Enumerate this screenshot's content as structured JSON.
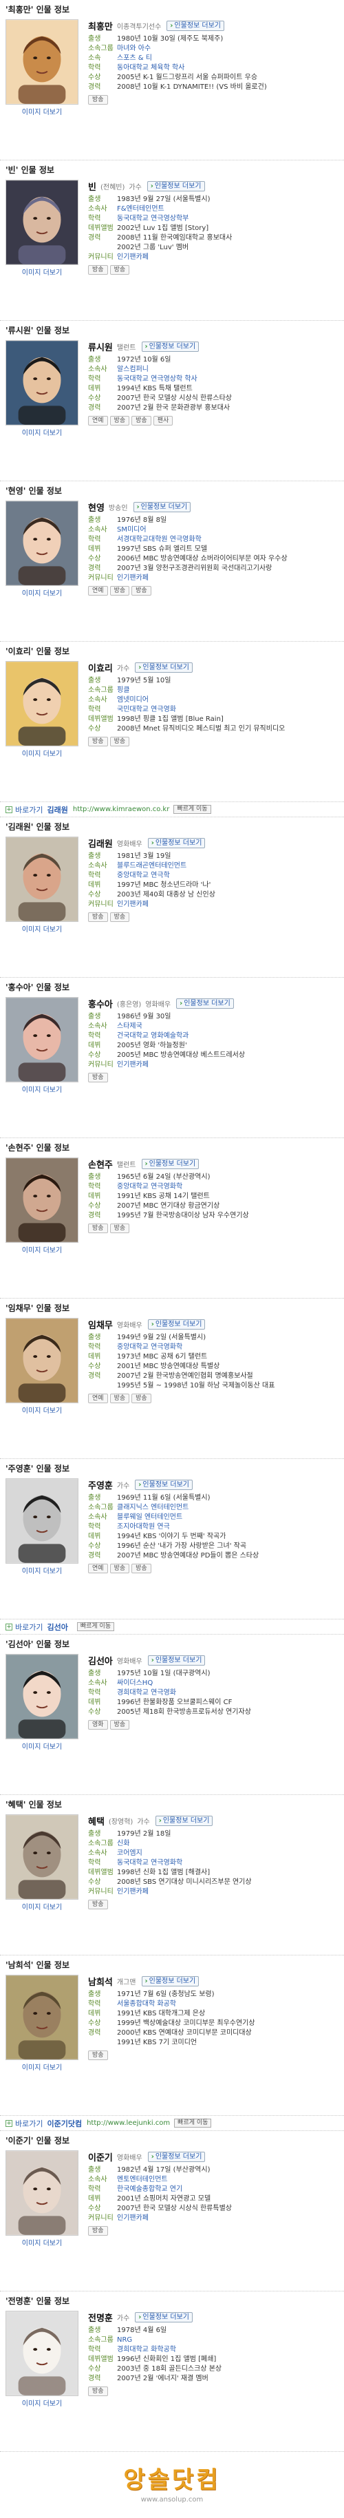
{
  "profiles": [
    {
      "section_title": "'최홍만' 인물 정보",
      "name": "최홍만",
      "sub": "이종격투기선수",
      "more": "인물정보 더보기",
      "fields": [
        {
          "k": "출생",
          "v": "1980년 10월 30일 (제주도 북제주)"
        },
        {
          "k": "소속그룹",
          "v": "마녀와 아수",
          "link": true
        },
        {
          "k": "소속",
          "v": "스포츠 & 티",
          "link": true
        },
        {
          "k": "학력",
          "v": "동아대학교 체육학 학사",
          "link": true
        },
        {
          "k": "수상",
          "v": "2005년 K-1 월드그랑프리 서울 슈퍼파이트 우승"
        },
        {
          "k": "경력",
          "v": "2008년 10월 K-1 DYNAMITE!! (VS 바비 올로건)"
        }
      ],
      "photo_link": "이미지 더보기",
      "tags": [
        "방송"
      ]
    },
    {
      "section_title": "'빈' 인물 정보",
      "name": "빈",
      "sub": "(전혜빈)",
      "role": "가수",
      "more": "인물정보 더보기",
      "fields": [
        {
          "k": "출생",
          "v": "1983년 9월 27일 (서울특별시)"
        },
        {
          "k": "소속사",
          "v": "F&엔터테인먼트",
          "link": true
        },
        {
          "k": "학력",
          "v": "동국대학교 연극영상학부",
          "link": true
        },
        {
          "k": "데뷔앨범",
          "v": "2002년 Luv 1집 앨범 [Story]"
        },
        {
          "k": "경력",
          "v": "2008년 11월 한국예임대학교 홍보대사"
        },
        {
          "k": "",
          "v": "2002년 그룹 'Luv' 멤버"
        },
        {
          "k": "커뮤니티",
          "v": "인기팬카페",
          "link": true
        }
      ],
      "photo_link": "이미지 더보기",
      "tags": [
        "방송",
        "방송"
      ]
    },
    {
      "section_title": "'류시원' 인물 정보",
      "name": "류시원",
      "role": "탤런트",
      "more": "인물정보 더보기",
      "fields": [
        {
          "k": "출생",
          "v": "1972년 10월 6일"
        },
        {
          "k": "소속사",
          "v": "알스컴퍼니",
          "link": true
        },
        {
          "k": "학력",
          "v": "동국대학교 연극영상학 학사",
          "link": true
        },
        {
          "k": "데뷔",
          "v": "1994년 KBS 특채 탤런트"
        },
        {
          "k": "수상",
          "v": "2007년 한국 모델상 시상식 한류스타상"
        },
        {
          "k": "경력",
          "v": "2007년 2월 한국 문화관광부 홍보대사"
        }
      ],
      "photo_link": "이미지 더보기",
      "tags": [
        "연예",
        "방송",
        "방송",
        "팬사"
      ]
    },
    {
      "section_title": "'현영' 인물 정보",
      "name": "현영",
      "role": "방송인",
      "more": "인물정보 더보기",
      "fields": [
        {
          "k": "출생",
          "v": "1976년 8월 8일"
        },
        {
          "k": "소속사",
          "v": "SM미디어",
          "link": true
        },
        {
          "k": "학력",
          "v": "서경대학교대학원 연극영화학",
          "link": true
        },
        {
          "k": "데뷔",
          "v": "1997년 SBS 슈퍼 엘리트 모델"
        },
        {
          "k": "수상",
          "v": "2006년 MBC 방송연예대상 쇼버라이어티부문 여자 우수상"
        },
        {
          "k": "경력",
          "v": "2007년 3월 양천구조경관리위원회 국선대리고기사랑"
        },
        {
          "k": "커뮤니티",
          "v": "인기팬카페",
          "link": true
        }
      ],
      "photo_link": "이미지 더보기",
      "tags": [
        "연예",
        "방송",
        "방송"
      ]
    },
    {
      "section_title": "'이효리' 인물 정보",
      "name": "이효리",
      "role": "가수",
      "more": "인물정보 더보기",
      "fields": [
        {
          "k": "출생",
          "v": "1979년 5월 10일"
        },
        {
          "k": "소속그룹",
          "v": "핑클",
          "link": true
        },
        {
          "k": "소속사",
          "v": "엠넷미디어",
          "link": true
        },
        {
          "k": "학력",
          "v": "국민대학교 연극영화",
          "link": true
        },
        {
          "k": "데뷔앨범",
          "v": "1998년 핑클 1집 앨범 [Blue Rain]"
        },
        {
          "k": "수상",
          "v": "2008년 Mnet 뮤직비디오 페스티벌 최고 인기 뮤직비디오"
        }
      ],
      "photo_link": "이미지 더보기",
      "tags": [
        "방송",
        "방송"
      ]
    },
    {
      "bar": {
        "label": "바로가기",
        "link": "김래원",
        "url": "http://www.kimraewon.co.kr",
        "btn": "빠르게 이동"
      },
      "section_title": "'김래원' 인물 정보",
      "name": "김래원",
      "role": "영화배우",
      "more": "인물정보 더보기",
      "fields": [
        {
          "k": "출생",
          "v": "1981년 3월 19일"
        },
        {
          "k": "소속사",
          "v": "블루드래곤엔터테인먼트",
          "link": true
        },
        {
          "k": "학력",
          "v": "중앙대학교 연극학",
          "link": true
        },
        {
          "k": "데뷔",
          "v": "1997년 MBC 청소년드라마 '나'"
        },
        {
          "k": "수상",
          "v": "2003년 제40회 대종상 남 신인상"
        },
        {
          "k": "커뮤니티",
          "v": "인기팬카페",
          "link": true
        }
      ],
      "photo_link": "이미지 더보기",
      "tags": [
        "방송",
        "방송"
      ]
    },
    {
      "section_title": "'홍수아' 인물 정보",
      "name": "홍수아",
      "sub": "(홍은영)",
      "role": "영화배우",
      "more": "인물정보 더보기",
      "fields": [
        {
          "k": "출생",
          "v": "1986년 9월 30일"
        },
        {
          "k": "소속사",
          "v": "스타제국",
          "link": true
        },
        {
          "k": "학력",
          "v": "건국대학교 영화예술학과",
          "link": true
        },
        {
          "k": "데뷔",
          "v": "2005년 영화 '하늘정원'"
        },
        {
          "k": "수상",
          "v": "2005년 MBC 방송연예대상 베스트드레서상"
        },
        {
          "k": "커뮤니티",
          "v": "인기팬카페",
          "link": true
        }
      ],
      "photo_link": "이미지 더보기",
      "tags": [
        "방송"
      ]
    },
    {
      "section_title": "'손현주' 인물 정보",
      "name": "손현주",
      "role": "탤런트",
      "more": "인물정보 더보기",
      "fields": [
        {
          "k": "출생",
          "v": "1965년 6월 24일 (부산광역시)"
        },
        {
          "k": "학력",
          "v": "중앙대학교 연극영화학",
          "link": true
        },
        {
          "k": "데뷔",
          "v": "1991년 KBS 공채 14기 탤런트"
        },
        {
          "k": "수상",
          "v": "2007년 MBC 연기대상 황금연기상"
        },
        {
          "k": "경력",
          "v": "1995년 7월 한국방송대이상 남자 우수연기상"
        }
      ],
      "photo_link": "이미지 더보기",
      "tags": [
        "방송",
        "방송"
      ]
    },
    {
      "section_title": "'임채무' 인물 정보",
      "name": "임채무",
      "role": "영화배우",
      "more": "인물정보 더보기",
      "fields": [
        {
          "k": "출생",
          "v": "1949년 9월 2일 (서울특별시)"
        },
        {
          "k": "학력",
          "v": "중앙대학교 연극영화학",
          "link": true
        },
        {
          "k": "데뷔",
          "v": "1973년 MBC 공채 6기 탤런트"
        },
        {
          "k": "수상",
          "v": "2001년 MBC 방송연예대상 특별상"
        },
        {
          "k": "경력",
          "v": "2007년 2월 한국방송연예인협회 명예홍보사절"
        },
        {
          "k": "",
          "v": "1995년 5월 ~ 1998년 10월 하남 국제놀이동산 대표"
        }
      ],
      "photo_link": "이미지 더보기",
      "tags": [
        "연예",
        "방송",
        "방송"
      ]
    },
    {
      "section_title": "'주영훈' 인물 정보",
      "name": "주영훈",
      "role": "가수",
      "more": "인물정보 더보기",
      "fields": [
        {
          "k": "출생",
          "v": "1969년 11월 6일 (서울특별시)"
        },
        {
          "k": "소속그룹",
          "v": "클래지닉스 엔터테인먼트",
          "link": true
        },
        {
          "k": "소속사",
          "v": "블루웨일 엔터테인먼트",
          "link": true
        },
        {
          "k": "학력",
          "v": "조지아대학원 연극",
          "link": true
        },
        {
          "k": "데뷔",
          "v": "1994년 KBS '이야기 두 번째' 작곡가"
        },
        {
          "k": "수상",
          "v": "1996년 순산 '내가 가장 사랑받은 그녀' 작곡"
        },
        {
          "k": "경력",
          "v": "2007년 MBC 방송연예대상 PD들이 뽑은 스타상"
        }
      ],
      "photo_link": "이미지 더보기",
      "tags": [
        "연예",
        "방송",
        "방송"
      ]
    },
    {
      "bar": {
        "label": "바로가기",
        "link": "김선아",
        "url": "",
        "btn": "빠르게 이동"
      },
      "section_title": "'김선아' 인물 정보",
      "name": "김선아",
      "role": "영화배우",
      "more": "인물정보 더보기",
      "fields": [
        {
          "k": "출생",
          "v": "1975년 10월 1일 (대구광역시)"
        },
        {
          "k": "소속사",
          "v": "싸이더스HQ",
          "link": true
        },
        {
          "k": "학력",
          "v": "경희대학교 연극영화",
          "link": true
        },
        {
          "k": "데뷔",
          "v": "1996년 한불화장품 오브쿨피스웨이 CF"
        },
        {
          "k": "수상",
          "v": "2005년 제18회 한국방송프로듀서상 연기자상"
        }
      ],
      "photo_link": "이미지 더보기",
      "tags": [
        "영화",
        "방송"
      ]
    },
    {
      "section_title": "'혜택' 인물 정보",
      "name": "혜택",
      "sub": "(장영혁)",
      "role": "가수",
      "more": "인물정보 더보기",
      "fields": [
        {
          "k": "출생",
          "v": "1979년 2월 18일"
        },
        {
          "k": "소속그룹",
          "v": "신화",
          "link": true
        },
        {
          "k": "소속사",
          "v": "코어엠지",
          "link": true
        },
        {
          "k": "학력",
          "v": "동국대학교 연극영화학",
          "link": true
        },
        {
          "k": "데뷔앨범",
          "v": "1998년 신화 1집 앨범 [해결사]"
        },
        {
          "k": "수상",
          "v": "2008년 SBS 연기대상 미니시리즈부문 연기상"
        },
        {
          "k": "커뮤니티",
          "v": "인기팬카페",
          "link": true
        }
      ],
      "photo_link": "이미지 더보기",
      "tags": [
        "방송"
      ]
    },
    {
      "section_title": "'남희석' 인물 정보",
      "name": "남희석",
      "role": "개그맨",
      "more": "인물정보 더보기",
      "fields": [
        {
          "k": "출생",
          "v": "1971년 7월 6일 (충청남도 보령)"
        },
        {
          "k": "학력",
          "v": "서울종합대학 화공학",
          "link": true
        },
        {
          "k": "데뷔",
          "v": "1991년 KBS 대학개그제 은상"
        },
        {
          "k": "수상",
          "v": "1999년 백상예술대상 코미디부문 최우수연기상"
        },
        {
          "k": "경력",
          "v": "2000년 KBS 연예대상 코미디부문 코미디대상"
        },
        {
          "k": "",
          "v": "1991년 KBS 7기 코미디언"
        }
      ],
      "photo_link": "이미지 더보기",
      "tags": [
        "방송"
      ]
    },
    {
      "bar": {
        "label": "바로가기",
        "link": "이준기닷컴",
        "url": "http://www.leejunki.com",
        "btn": "빠르게 이동"
      },
      "section_title": "'이준기' 인물 정보",
      "name": "이준기",
      "role": "영화배우",
      "more": "인물정보 더보기",
      "fields": [
        {
          "k": "출생",
          "v": "1982년 4월 17일 (부산광역시)"
        },
        {
          "k": "소속사",
          "v": "멘토엔터테인먼트",
          "link": true
        },
        {
          "k": "학력",
          "v": "한국예술종합학교 연기",
          "link": true
        },
        {
          "k": "데뷔",
          "v": "2001년 쇼핑머치 자연광고 모델"
        },
        {
          "k": "수상",
          "v": "2007년 한국 모델상 시상식 한류특별상"
        },
        {
          "k": "커뮤니티",
          "v": "인기팬카페",
          "link": true
        }
      ],
      "photo_link": "이미지 더보기",
      "tags": [
        "방송"
      ]
    },
    {
      "section_title": "'전명훈' 인물 정보",
      "name": "전명훈",
      "role": "가수",
      "more": "인물정보 더보기",
      "fields": [
        {
          "k": "출생",
          "v": "1978년 4월 6일"
        },
        {
          "k": "소속그룹",
          "v": "NRG",
          "link": true
        },
        {
          "k": "학력",
          "v": "경희대학교 화학공학",
          "link": true
        },
        {
          "k": "데뷔앨범",
          "v": "1996년 신화회인 1집 앨범 [폐쇄]"
        },
        {
          "k": "수상",
          "v": "2003년 중 18회 골든디스크상 본상"
        },
        {
          "k": "경력",
          "v": "2007년 2월 '에너지' 재결 멤버"
        }
      ],
      "photo_link": "이미지 더보기",
      "tags": [
        "방송"
      ]
    }
  ],
  "footer": {
    "logo": "앙솔닷컴",
    "url": "www.ansolup.com"
  },
  "colors": {
    "link": "#2a5db0",
    "label_green": "#5a8a2a",
    "logo": "#e8a020"
  }
}
